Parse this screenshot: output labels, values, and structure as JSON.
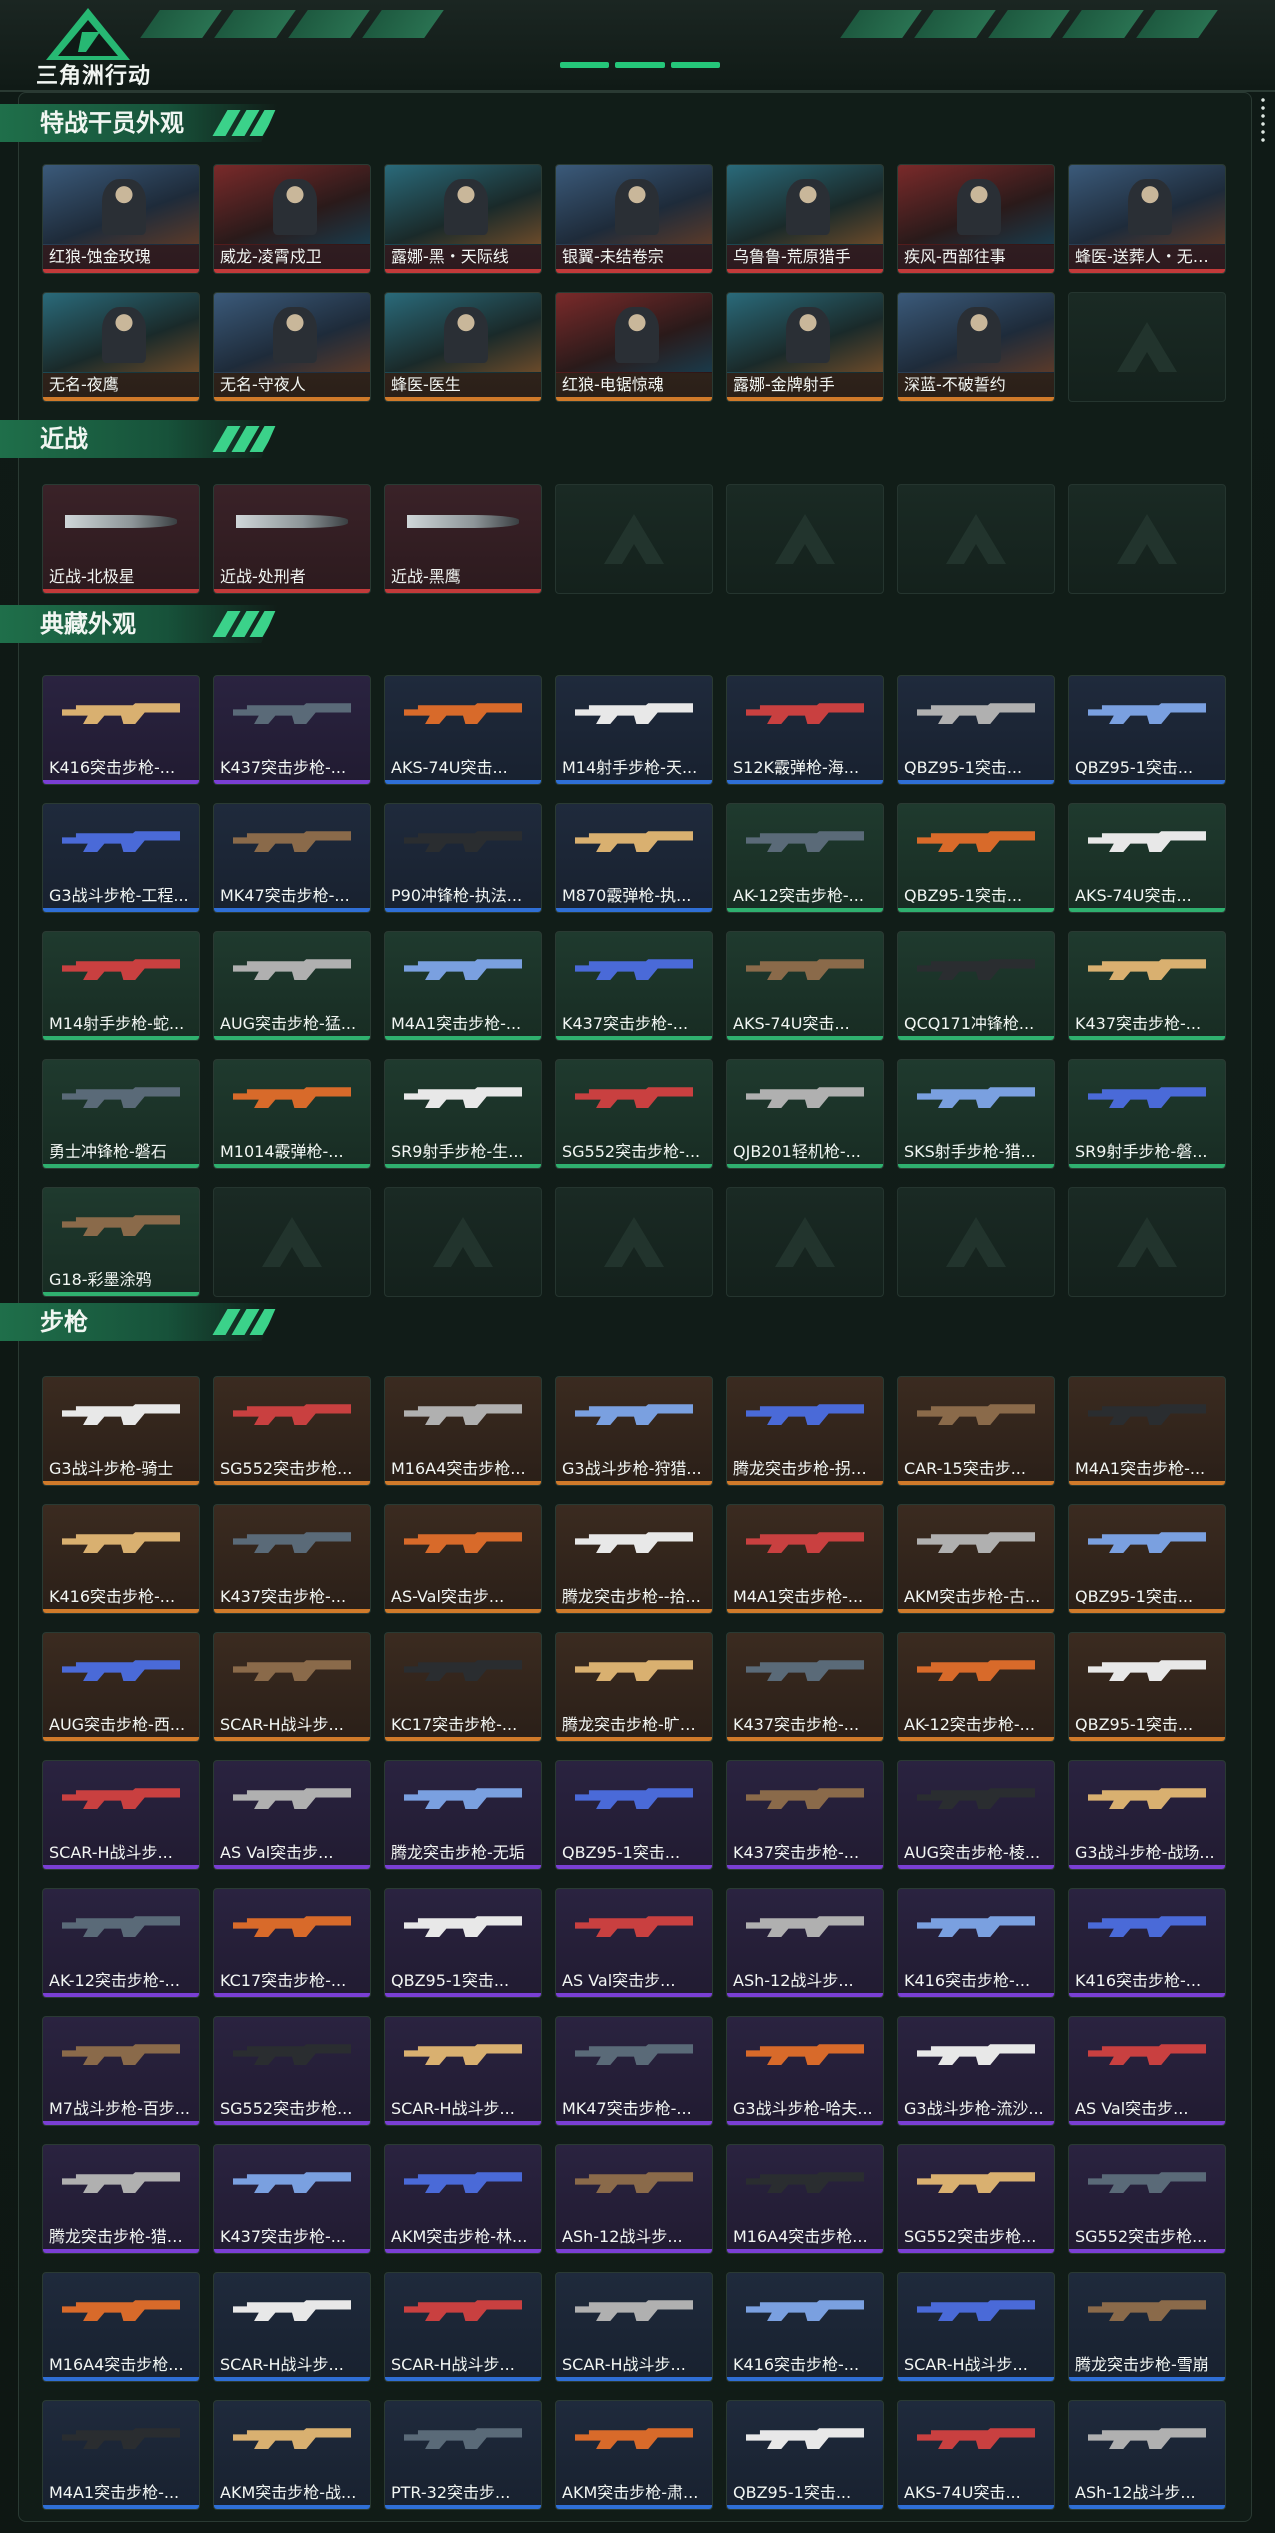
{
  "header": {
    "logo_text": "三角洲行动"
  },
  "sections": [
    {
      "title": "特战干员外观",
      "kind": "agent",
      "items": [
        {
          "label": "红狼-蚀金玫瑰",
          "rarity": "red",
          "tone": "t1"
        },
        {
          "label": "威龙-凌霄戍卫",
          "rarity": "red",
          "tone": "t2"
        },
        {
          "label": "露娜-黑・天际线",
          "rarity": "red",
          "tone": "t3"
        },
        {
          "label": "银翼-未结卷宗",
          "rarity": "red",
          "tone": "t1"
        },
        {
          "label": "乌鲁鲁-荒原猎手",
          "rarity": "red",
          "tone": "t3"
        },
        {
          "label": "疾风-西部往事",
          "rarity": "red",
          "tone": "t2"
        },
        {
          "label": "蜂医-送葬人・无题...",
          "rarity": "red",
          "tone": "t1"
        },
        {
          "label": "无名-夜鹰",
          "rarity": "orange",
          "tone": "t3"
        },
        {
          "label": "无名-守夜人",
          "rarity": "orange",
          "tone": "t1"
        },
        {
          "label": "蜂医-医生",
          "rarity": "orange",
          "tone": "t3"
        },
        {
          "label": "红狼-电锯惊魂",
          "rarity": "orange",
          "tone": "t2"
        },
        {
          "label": "露娜-金牌射手",
          "rarity": "orange",
          "tone": "t3"
        },
        {
          "label": "深蓝-不破誓约",
          "rarity": "orange",
          "tone": "t1"
        },
        {
          "label": "",
          "rarity": "none"
        }
      ]
    },
    {
      "title": "近战",
      "kind": "melee",
      "items": [
        {
          "label": "近战-北极星",
          "rarity": "red"
        },
        {
          "label": "近战-处刑者",
          "rarity": "red"
        },
        {
          "label": "近战-黑鹰",
          "rarity": "red"
        },
        {
          "label": "",
          "rarity": "none"
        },
        {
          "label": "",
          "rarity": "none"
        },
        {
          "label": "",
          "rarity": "none"
        },
        {
          "label": "",
          "rarity": "none"
        }
      ]
    },
    {
      "title": "典藏外观",
      "kind": "gun",
      "items": [
        {
          "label": "K416突击步枪-...",
          "rarity": "purple"
        },
        {
          "label": "K437突击步枪-...",
          "rarity": "purple"
        },
        {
          "label": "AKS-74U突击...",
          "rarity": "blue"
        },
        {
          "label": "M14射手步枪-天...",
          "rarity": "blue"
        },
        {
          "label": "S12K霰弹枪-海...",
          "rarity": "blue"
        },
        {
          "label": "QBZ95-1突击...",
          "rarity": "blue"
        },
        {
          "label": "QBZ95-1突击...",
          "rarity": "blue"
        },
        {
          "label": "G3战斗步枪-工程...",
          "rarity": "blue"
        },
        {
          "label": "MK47突击步枪-...",
          "rarity": "blue"
        },
        {
          "label": "P90冲锋枪-执法...",
          "rarity": "blue"
        },
        {
          "label": "M870霰弹枪-执...",
          "rarity": "blue"
        },
        {
          "label": "AK-12突击步枪-...",
          "rarity": "green"
        },
        {
          "label": "QBZ95-1突击...",
          "rarity": "green"
        },
        {
          "label": "AKS-74U突击...",
          "rarity": "green"
        },
        {
          "label": "M14射手步枪-蛇...",
          "rarity": "green"
        },
        {
          "label": "AUG突击步枪-猛...",
          "rarity": "green"
        },
        {
          "label": "M4A1突击步枪-...",
          "rarity": "green"
        },
        {
          "label": "K437突击步枪-...",
          "rarity": "green"
        },
        {
          "label": "AKS-74U突击...",
          "rarity": "green"
        },
        {
          "label": "QCQ171冲锋枪...",
          "rarity": "green"
        },
        {
          "label": "K437突击步枪-...",
          "rarity": "green"
        },
        {
          "label": "勇士冲锋枪-磐石",
          "rarity": "green"
        },
        {
          "label": "M1014霰弹枪-...",
          "rarity": "green"
        },
        {
          "label": "SR9射手步枪-生...",
          "rarity": "green"
        },
        {
          "label": "SG552突击步枪-...",
          "rarity": "green"
        },
        {
          "label": "QJB201轻机枪-...",
          "rarity": "green"
        },
        {
          "label": "SKS射手步枪-猎...",
          "rarity": "green"
        },
        {
          "label": "SR9射手步枪-磐...",
          "rarity": "green"
        },
        {
          "label": "G18-彩墨涂鸦",
          "rarity": "green"
        },
        {
          "label": "",
          "rarity": "none"
        },
        {
          "label": "",
          "rarity": "none"
        },
        {
          "label": "",
          "rarity": "none"
        },
        {
          "label": "",
          "rarity": "none"
        },
        {
          "label": "",
          "rarity": "none"
        },
        {
          "label": "",
          "rarity": "none"
        }
      ]
    },
    {
      "title": "步枪",
      "kind": "gun",
      "items": [
        {
          "label": "G3战斗步枪-骑士",
          "rarity": "orange"
        },
        {
          "label": "SG552突击步枪...",
          "rarity": "orange"
        },
        {
          "label": "M16A4突击步枪...",
          "rarity": "orange"
        },
        {
          "label": "G3战斗步枪-狩猎...",
          "rarity": "orange"
        },
        {
          "label": "腾龙突击步枪-拐点...",
          "rarity": "orange"
        },
        {
          "label": "CAR-15突击步...",
          "rarity": "orange"
        },
        {
          "label": "M4A1突击步枪-...",
          "rarity": "orange"
        },
        {
          "label": "K416突击步枪-...",
          "rarity": "orange"
        },
        {
          "label": "K437突击步枪-...",
          "rarity": "orange"
        },
        {
          "label": "AS-Val突击步...",
          "rarity": "orange"
        },
        {
          "label": "腾龙突击步枪--拾...",
          "rarity": "orange"
        },
        {
          "label": "M4A1突击步枪-...",
          "rarity": "orange"
        },
        {
          "label": "AKM突击步枪-古...",
          "rarity": "orange"
        },
        {
          "label": "QBZ95-1突击...",
          "rarity": "orange"
        },
        {
          "label": "AUG突击步枪-西...",
          "rarity": "orange"
        },
        {
          "label": "SCAR-H战斗步...",
          "rarity": "orange"
        },
        {
          "label": "KC17突击步枪-...",
          "rarity": "orange"
        },
        {
          "label": "腾龙突击步枪-旷野...",
          "rarity": "orange"
        },
        {
          "label": "K437突击步枪-...",
          "rarity": "orange"
        },
        {
          "label": "AK-12突击步枪-...",
          "rarity": "orange"
        },
        {
          "label": "QBZ95-1突击...",
          "rarity": "orange"
        },
        {
          "label": "SCAR-H战斗步...",
          "rarity": "purple"
        },
        {
          "label": "AS Val突击步...",
          "rarity": "purple"
        },
        {
          "label": "腾龙突击步枪-无垢",
          "rarity": "purple"
        },
        {
          "label": "QBZ95-1突击...",
          "rarity": "purple"
        },
        {
          "label": "K437突击步枪-...",
          "rarity": "purple"
        },
        {
          "label": "AUG突击步枪-棱...",
          "rarity": "purple"
        },
        {
          "label": "G3战斗步枪-战场...",
          "rarity": "purple"
        },
        {
          "label": "AK-12突击步枪-...",
          "rarity": "purple"
        },
        {
          "label": "KC17突击步枪-...",
          "rarity": "purple"
        },
        {
          "label": "QBZ95-1突击...",
          "rarity": "purple"
        },
        {
          "label": "AS Val突击步...",
          "rarity": "purple"
        },
        {
          "label": "ASh-12战斗步...",
          "rarity": "purple"
        },
        {
          "label": "K416突击步枪-...",
          "rarity": "purple"
        },
        {
          "label": "K416突击步枪-...",
          "rarity": "purple"
        },
        {
          "label": "M7战斗步枪-百步...",
          "rarity": "purple"
        },
        {
          "label": "SG552突击步枪...",
          "rarity": "purple"
        },
        {
          "label": "SCAR-H战斗步...",
          "rarity": "purple"
        },
        {
          "label": "MK47突击步枪-...",
          "rarity": "purple"
        },
        {
          "label": "G3战斗步枪-哈夫...",
          "rarity": "purple"
        },
        {
          "label": "G3战斗步枪-流沙...",
          "rarity": "purple"
        },
        {
          "label": "AS Val突击步...",
          "rarity": "purple"
        },
        {
          "label": "腾龙突击步枪-猎鳄...",
          "rarity": "purple"
        },
        {
          "label": "K437突击步枪-...",
          "rarity": "purple"
        },
        {
          "label": "AKM突击步枪-林...",
          "rarity": "purple"
        },
        {
          "label": "ASh-12战斗步...",
          "rarity": "purple"
        },
        {
          "label": "M16A4突击步枪...",
          "rarity": "purple"
        },
        {
          "label": "SG552突击步枪...",
          "rarity": "purple"
        },
        {
          "label": "SG552突击步枪...",
          "rarity": "purple"
        },
        {
          "label": "M16A4突击步枪...",
          "rarity": "blue"
        },
        {
          "label": "SCAR-H战斗步...",
          "rarity": "blue"
        },
        {
          "label": "SCAR-H战斗步...",
          "rarity": "blue"
        },
        {
          "label": "SCAR-H战斗步...",
          "rarity": "blue"
        },
        {
          "label": "K416突击步枪-...",
          "rarity": "blue"
        },
        {
          "label": "SCAR-H战斗步...",
          "rarity": "blue"
        },
        {
          "label": "腾龙突击步枪-雪崩",
          "rarity": "blue"
        },
        {
          "label": "M4A1突击步枪-...",
          "rarity": "blue"
        },
        {
          "label": "AKM突击步枪-战...",
          "rarity": "blue"
        },
        {
          "label": "PTR-32突击步...",
          "rarity": "blue"
        },
        {
          "label": "AKM突击步枪-肃...",
          "rarity": "blue"
        },
        {
          "label": "QBZ95-1突击...",
          "rarity": "blue"
        },
        {
          "label": "AKS-74U突击...",
          "rarity": "blue"
        },
        {
          "label": "ASh-12战斗步...",
          "rarity": "blue"
        }
      ]
    }
  ]
}
